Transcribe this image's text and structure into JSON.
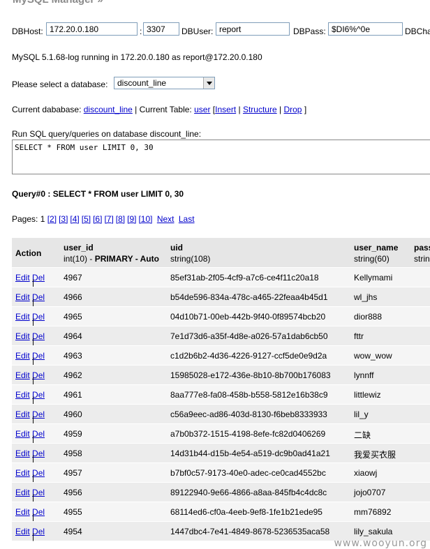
{
  "header": {
    "title": "MySQL Manager »"
  },
  "connection": {
    "host_label": "DBHost:",
    "host": "172.20.0.180",
    "port_sep": ":",
    "port": "3307",
    "user_label": "DBUser:",
    "user": "report",
    "pass_label": "DBPass:",
    "pass": "$DI6%^0e",
    "charset_label": "DBCha"
  },
  "status": "MySQL 5.1.68-log running in 172.20.0.180 as report@172.20.0.180",
  "db_select": {
    "label": "Please select a database:",
    "value": "discount_line"
  },
  "current": {
    "db_label": "Current dababase:",
    "db": "discount_line",
    "table_label": "| Current Table:",
    "table": "user",
    "sep_open": "[",
    "insert": "Insert",
    "sep1": "|",
    "structure": "Structure",
    "sep2": "|",
    "drop": "Drop",
    "sep_close": "]"
  },
  "query": {
    "label": "Run SQL query/queries on database discount_line:",
    "sql": "SELECT * FROM user LIMIT 0, 30",
    "result_title": "Query#0 : SELECT * FROM user LIMIT 0, 30"
  },
  "pages": {
    "label": "Pages: 1",
    "links": [
      "[2]",
      "[3]",
      "[4]",
      "[5]",
      "[6]",
      "[7]",
      "[8]",
      "[9]",
      "[10]"
    ],
    "next": "Next",
    "last": "Last"
  },
  "table": {
    "headers": {
      "action": "Action",
      "c1_name": "user_id",
      "c1_type": "int(10)",
      "c1_dash": " - ",
      "c1_key": "PRIMARY",
      "c1_auto": " - Auto",
      "c2_name": "uid",
      "c2_type": "string(108)",
      "c3_name": "user_name",
      "c3_type": "string(60)",
      "c4_name": "pass",
      "c4_type": "strin"
    },
    "edit": "Edit",
    "sep": "|",
    "del": "Del",
    "rows": [
      {
        "id": "4967",
        "uid": "85ef31ab-2f05-4cf9-a7c6-ce4f11c20a18",
        "name": "Kellymami"
      },
      {
        "id": "4966",
        "uid": "b54de596-834a-478c-a465-22feaa4b45d1",
        "name": "wl_jhs"
      },
      {
        "id": "4965",
        "uid": "04d10b71-00eb-442b-9f40-0f89574bcb20",
        "name": "dior888"
      },
      {
        "id": "4964",
        "uid": "7e1d73d6-a35f-4d8e-a026-57a1dab6cb50",
        "name": "fttr"
      },
      {
        "id": "4963",
        "uid": "c1d2b6b2-4d36-4226-9127-ccf5de0e9d2a",
        "name": "wow_wow"
      },
      {
        "id": "4962",
        "uid": "15985028-e172-436e-8b10-8b700b176083",
        "name": "lynnff"
      },
      {
        "id": "4961",
        "uid": "8aa777e8-fa08-458b-b558-5812e16b38c9",
        "name": "littlewiz"
      },
      {
        "id": "4960",
        "uid": "c56a9eec-ad86-403d-8130-f6beb8333933",
        "name": "lil_y"
      },
      {
        "id": "4959",
        "uid": "a7b0b372-1515-4198-8efe-fc82d0406269",
        "name": "二缺"
      },
      {
        "id": "4958",
        "uid": "14d31b44-d15b-4e54-a519-dc9b0ad41a21",
        "name": "我爱买衣服"
      },
      {
        "id": "4957",
        "uid": "b7bf0c57-9173-40e0-adec-ce0cad4552bc",
        "name": "xiaowj"
      },
      {
        "id": "4956",
        "uid": "89122940-9e66-4866-a8aa-845fb4c4dc8c",
        "name": "jojo0707"
      },
      {
        "id": "4955",
        "uid": "68114ed6-cf0a-4eeb-9ef8-1fe1b21ede95",
        "name": "mm76892"
      },
      {
        "id": "4954",
        "uid": "1447dbc4-7e41-4849-8678-5236535aca58",
        "name": "lily_sakula"
      }
    ]
  },
  "watermark": "www.wooyun.org",
  "colors": {
    "link": "#0000cc",
    "header_bg": "#e6e6e6",
    "row_bg": "#f5f5f5"
  }
}
